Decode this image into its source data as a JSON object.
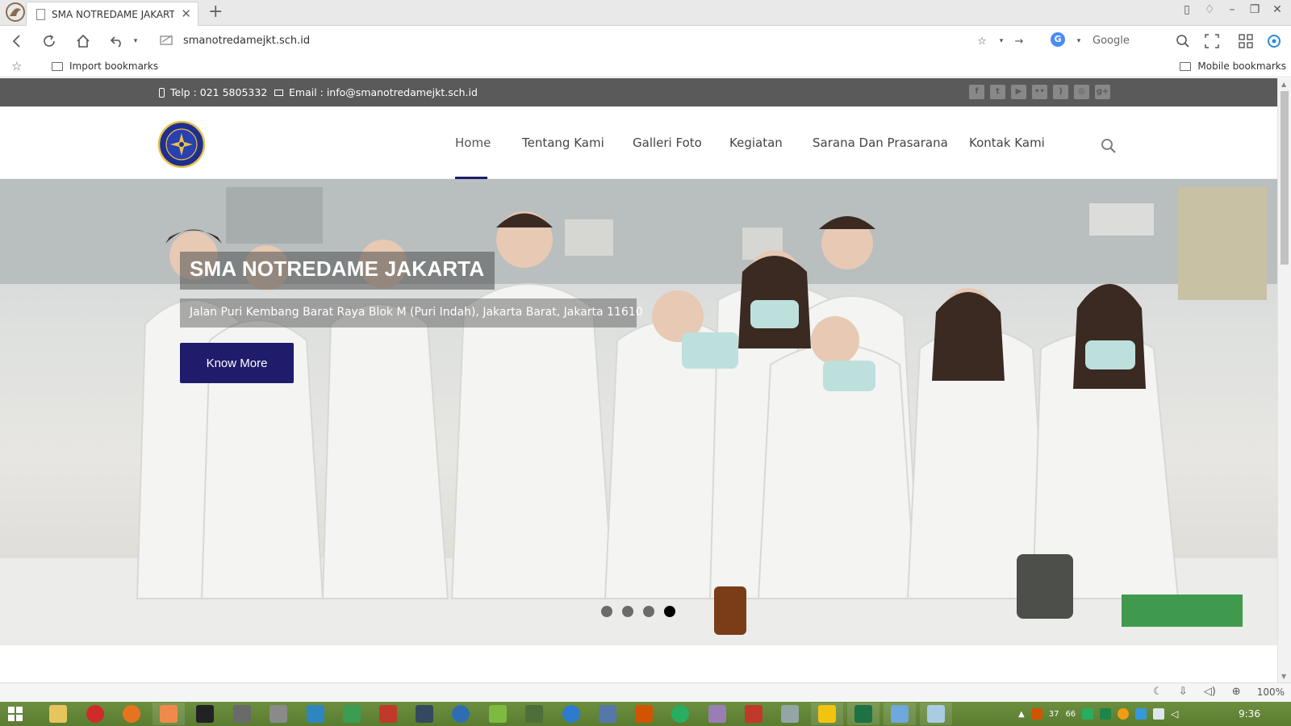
{
  "browser": {
    "tab_title": "SMA NOTREDAME JAKARTA |",
    "url": "smanotredamejkt.sch.id",
    "search_engine_name": "Google",
    "search_engine_badge": "G",
    "bookmarks": {
      "import_label": "Import bookmarks",
      "mobile_label": "Mobile bookmarks"
    },
    "zoom": "100%"
  },
  "site": {
    "topbar": {
      "phone": "Telp : 021 5805332",
      "email": "Email : info@smanotredamejkt.sch.id",
      "social_icons": [
        "facebook-icon",
        "twitter-icon",
        "youtube-icon",
        "flickr-icon",
        "rss-icon",
        "instagram-icon",
        "google-plus-icon"
      ]
    },
    "nav": {
      "items": [
        {
          "label": "Home",
          "active": true
        },
        {
          "label": "Tentang Kami"
        },
        {
          "label": "Galleri Foto"
        },
        {
          "label": "Kegiatan"
        },
        {
          "label": "Sarana Dan Prasarana"
        },
        {
          "label": "Kontak Kami"
        }
      ]
    },
    "hero": {
      "title": "SMA NOTREDAME JAKARTA",
      "subtitle": "Jalan Puri Kembang Barat Raya Blok M (Puri Indah), Jakarta Barat, Jakarta 11610",
      "button_label": "Know More",
      "slide_count": 4,
      "active_slide": 4
    }
  },
  "taskbar": {
    "clock": "9:36",
    "tray_badge_1": "37",
    "tray_badge_2": "66"
  },
  "colors": {
    "brand_navy": "#1e1c6b",
    "topbar_bg": "#5a5a5a",
    "taskbar_green": "#5a7c30"
  }
}
